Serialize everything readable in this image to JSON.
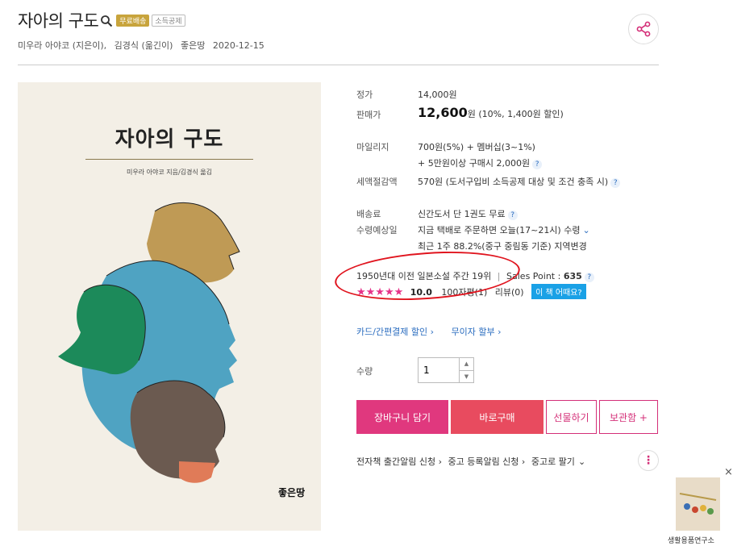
{
  "book": {
    "title": "자아의 구도",
    "badge_free": "무료배송",
    "badge_tax": "소득공제",
    "author": "미우라 아야코 (지은이),",
    "translator": "김경식 (옮긴이)",
    "publisher": "좋은땅",
    "date": "2020-12-15"
  },
  "cover": {
    "title": "자아의 구도",
    "authors": "미우라 아야코 지음/김경식 옮김",
    "publisher": "좋은땅"
  },
  "price": {
    "list_label": "정가",
    "list_value": "14,000원",
    "sale_label": "판매가",
    "sale_value": "12,600",
    "sale_unit": "원",
    "sale_note": "(10%, 1,400원 할인)"
  },
  "mileage": {
    "label": "마일리지",
    "line1": "700원(5%) + 멤버십(3~1%)",
    "line2": "+ 5만원이상 구매시 2,000원"
  },
  "tax": {
    "label": "세액절감액",
    "value": "570원 (도서구입비 소득공제 대상 및 조건 충족 시)"
  },
  "shipping": {
    "label": "배송료",
    "value": "신간도서 단 1권도 무료"
  },
  "delivery": {
    "label": "수령예상일",
    "line1": "지금 택배로 주문하면 오늘(17~21시) 수령",
    "line2": "최근 1주 88.2%(중구 중림동 기준) 지역변경"
  },
  "ranking": {
    "text": "1950년대 이전 일본소설 주간 19위",
    "sep": "|",
    "sales_label": "Sales Point : ",
    "sales_value": "635"
  },
  "review": {
    "stars": "★★★★★",
    "score": "10.0",
    "review_count": "100자평(1)",
    "review_label": "리뷰(0)",
    "curious": "이 책 어때요?",
    "rating_value": 10.0
  },
  "links": {
    "card": "카드/간편결제 할인 ›",
    "installment": "무이자 할부 ›"
  },
  "qty": {
    "label": "수량",
    "value": "1"
  },
  "buttons": {
    "cart": "장바구니 담기",
    "buy": "바로구매",
    "gift": "선물하기",
    "keep": "보관함 +"
  },
  "bottom": {
    "ebook": "전자책 출간알림 신청 ›",
    "used_alert": "중고 등록알림 신청 ›",
    "used_sell": "중고로 팔기",
    "more": "⋮"
  },
  "ad": {
    "label": "생활용품연구소",
    "close": "×"
  },
  "colors": {
    "accent": "#e0387e",
    "buy": "#e84b5f",
    "link": "#2a6cbf",
    "badge_gold": "#c8a43c",
    "highlight": "#e0141e"
  }
}
